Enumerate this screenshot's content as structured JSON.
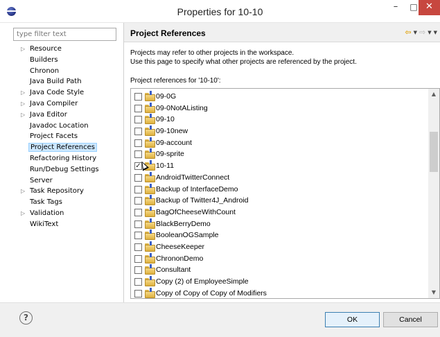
{
  "window": {
    "title": "Properties for 10-10",
    "minimize_glyph": "–",
    "maximize_glyph": "□",
    "close_glyph": "✕"
  },
  "sidebar": {
    "filter_placeholder": "type filter text",
    "items": [
      {
        "label": "Resource",
        "expandable": true
      },
      {
        "label": "Builders",
        "expandable": false
      },
      {
        "label": "Chronon",
        "expandable": false
      },
      {
        "label": "Java Build Path",
        "expandable": false
      },
      {
        "label": "Java Code Style",
        "expandable": true
      },
      {
        "label": "Java Compiler",
        "expandable": true
      },
      {
        "label": "Java Editor",
        "expandable": true
      },
      {
        "label": "Javadoc Location",
        "expandable": false
      },
      {
        "label": "Project Facets",
        "expandable": false
      },
      {
        "label": "Project References",
        "expandable": false,
        "selected": true
      },
      {
        "label": "Refactoring History",
        "expandable": false
      },
      {
        "label": "Run/Debug Settings",
        "expandable": false
      },
      {
        "label": "Server",
        "expandable": false
      },
      {
        "label": "Task Repository",
        "expandable": true
      },
      {
        "label": "Task Tags",
        "expandable": false
      },
      {
        "label": "Validation",
        "expandable": true
      },
      {
        "label": "WikiText",
        "expandable": false
      }
    ]
  },
  "page": {
    "title": "Project References",
    "description_line1": "Projects may refer to other projects in the workspace.",
    "description_line2": "Use this page to specify what other projects are referenced by the project.",
    "refs_label": "Project references for '10-10':",
    "projects": [
      {
        "name": "09-0G",
        "checked": false
      },
      {
        "name": "09-0NotAListing",
        "checked": false
      },
      {
        "name": "09-10",
        "checked": false
      },
      {
        "name": "09-10new",
        "checked": false
      },
      {
        "name": "09-account",
        "checked": false
      },
      {
        "name": "09-sprite",
        "checked": false
      },
      {
        "name": "10-11",
        "checked": true
      },
      {
        "name": "AndroidTwitterConnect",
        "checked": false
      },
      {
        "name": "Backup of InterfaceDemo",
        "checked": false
      },
      {
        "name": "Backup of Twitter4J_Android",
        "checked": false
      },
      {
        "name": "BagOfCheeseWithCount",
        "checked": false
      },
      {
        "name": "BlackBerryDemo",
        "checked": false
      },
      {
        "name": "BooleanOGSample",
        "checked": false
      },
      {
        "name": "CheeseKeeper",
        "checked": false
      },
      {
        "name": "ChrononDemo",
        "checked": false
      },
      {
        "name": "Consultant",
        "checked": false
      },
      {
        "name": "Copy (2) of EmployeeSimple",
        "checked": false
      },
      {
        "name": "Copy of Copy of Copy of Modifiers",
        "checked": false
      }
    ]
  },
  "footer": {
    "help_glyph": "?",
    "ok_label": "OK",
    "cancel_label": "Cancel"
  },
  "icons": {
    "folder": "project-folder-icon",
    "expand": "expand-arrow-icon",
    "back": "back-arrow-icon",
    "forward": "forward-arrow-icon"
  }
}
